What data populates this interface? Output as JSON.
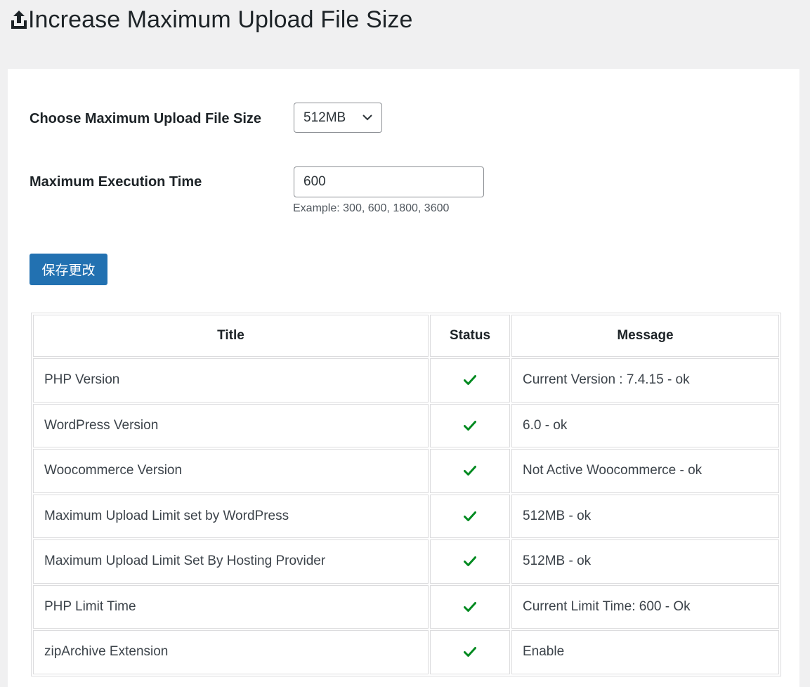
{
  "header": {
    "icon": "upload-icon",
    "title": "Increase Maximum Upload File Size"
  },
  "form": {
    "upload_size_label": "Choose Maximum Upload File Size",
    "upload_size_value": "512MB",
    "execution_time_label": "Maximum Execution Time",
    "execution_time_value": "600",
    "execution_time_hint": "Example: 300, 600, 1800, 3600",
    "save_label": "保存更改"
  },
  "table": {
    "headers": [
      "Title",
      "Status",
      "Message"
    ],
    "rows": [
      {
        "title": "PHP Version",
        "status_icon": "check-icon",
        "message": "Current Version : 7.4.15 - ok"
      },
      {
        "title": "WordPress Version",
        "status_icon": "check-icon",
        "message": "6.0 - ok"
      },
      {
        "title": "Woocommerce Version",
        "status_icon": "check-icon",
        "message": "Not Active Woocommerce - ok"
      },
      {
        "title": "Maximum Upload Limit set by WordPress",
        "status_icon": "check-icon",
        "message": "512MB - ok"
      },
      {
        "title": "Maximum Upload Limit Set By Hosting Provider",
        "status_icon": "check-icon",
        "message": "512MB - ok"
      },
      {
        "title": "PHP Limit Time",
        "status_icon": "check-icon",
        "message": "Current Limit Time: 600 - Ok"
      },
      {
        "title": "zipArchive Extension",
        "status_icon": "check-icon",
        "message": "Enable"
      }
    ]
  },
  "colors": {
    "background": "#f0f0f1",
    "panel": "#ffffff",
    "primary_button": "#2271b1",
    "check": "#008a20",
    "border": "#dcdcde"
  }
}
